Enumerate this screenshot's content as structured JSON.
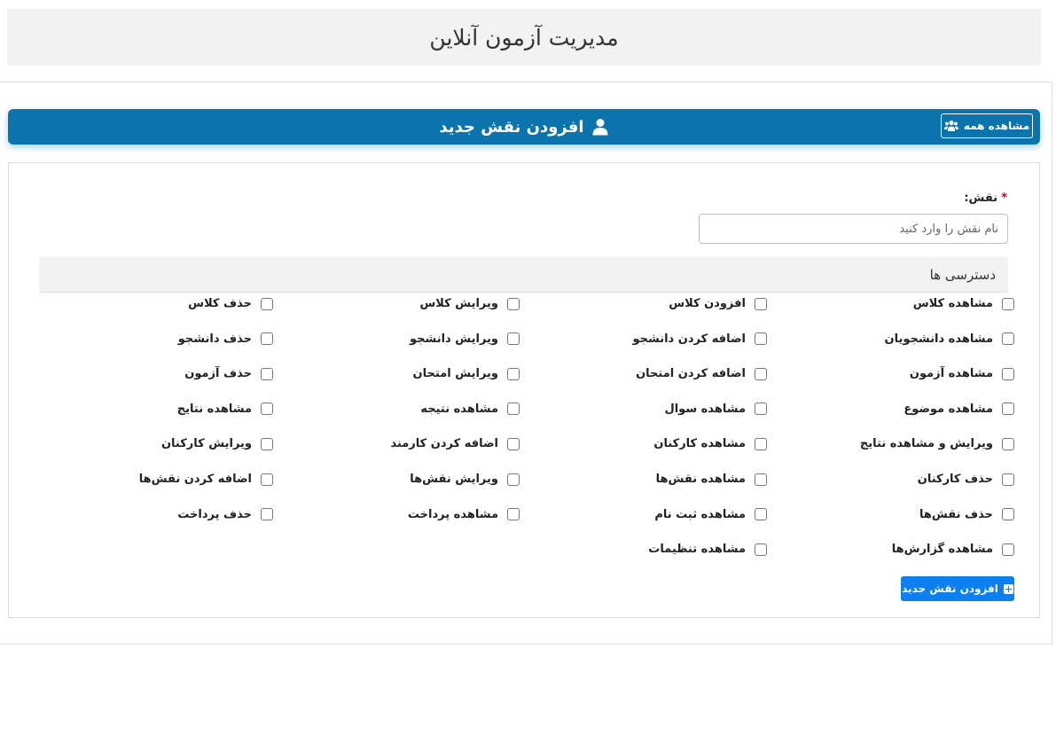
{
  "app": {
    "title": "مدیریت آزمون آنلاین"
  },
  "header": {
    "title": "افزودن نقش جدید",
    "view_all_label": "مشاهده همه"
  },
  "form": {
    "role_label": "نقش:",
    "required_mark": "*",
    "role_value": "",
    "role_placeholder": "نام نقش را وارد کنید",
    "permissions_title": "دسترسی ها",
    "submit_label": "افزودن نقش جدید"
  },
  "permissions": {
    "columns": [
      [
        "مشاهده کلاس",
        "مشاهده دانشجویان",
        "مشاهده آزمون",
        "مشاهده موضوع",
        "ویرایش و مشاهده نتایج",
        "حذف کارکنان",
        "حذف نقش‌ها",
        "مشاهده گزارش‌ها"
      ],
      [
        "افزودن کلاس",
        "اضافه کردن دانشجو",
        "اضافه کردن امتحان",
        "مشاهده سوال",
        "مشاهده کارکنان",
        "مشاهده نقش‌ها",
        "مشاهده ثبت نام",
        "مشاهده تنظیمات"
      ],
      [
        "ویرایش کلاس",
        "ویرایش دانشجو",
        "ویرایش امتحان",
        "مشاهده نتیجه",
        "اضافه کردن کارمند",
        "ویرایش نقش‌ها",
        "مشاهده پرداخت"
      ],
      [
        "حذف کلاس",
        "حذف دانشجو",
        "حذف آزمون",
        "مشاهده نتایج",
        "ویرایش کارکنان",
        "اضافه کردن نقش‌ها",
        "حذف پرداخت"
      ]
    ]
  },
  "icons": {
    "user": "user-icon",
    "users": "users-icon",
    "plus": "plus-square-icon"
  },
  "colors": {
    "header_bg": "#0b74ad",
    "submit_bg": "#0d7ff0",
    "required": "#d0021b"
  }
}
